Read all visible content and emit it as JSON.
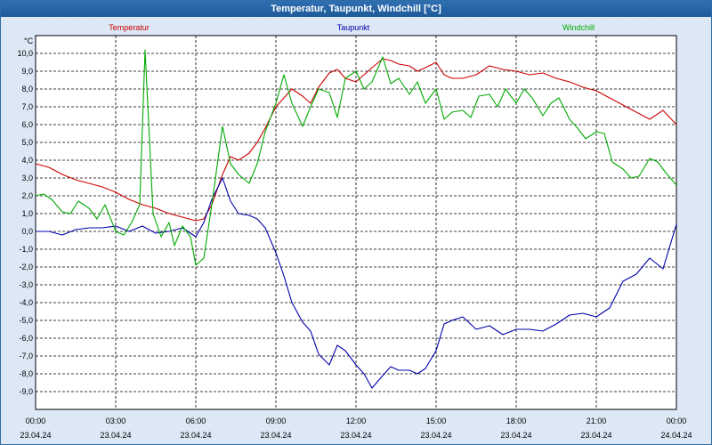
{
  "window": {
    "title": "Temperatur, Taupunkt, Windchill [°C]"
  },
  "colors": {
    "background": "#dce8f5",
    "plot_background": "#ffffff",
    "title_bar": "#2467a8",
    "grid": "#000000",
    "temperatur": "#cc0000",
    "taupunkt": "#0000aa",
    "windchill": "#00aa00"
  },
  "chart_data": {
    "type": "line",
    "title": "Temperatur, Taupunkt, Windchill [°C]",
    "ylabel": "°C",
    "ylim": [
      -10,
      11
    ],
    "xlim": [
      0,
      24
    ],
    "yticks": [
      -9,
      -8,
      -7,
      -6,
      -5,
      -4,
      -3,
      -2,
      -1,
      0,
      1,
      2,
      3,
      4,
      5,
      6,
      7,
      8,
      9,
      10
    ],
    "ytick_labels": [
      "-9,0",
      "-8,0",
      "-7,0",
      "-6,0",
      "-5,0",
      "-4,0",
      "-3,0",
      "-2,0",
      "-1,0",
      "0,0",
      "1,0",
      "2,0",
      "3,0",
      "4,0",
      "5,0",
      "6,0",
      "7,0",
      "8,0",
      "9,0",
      "10,0"
    ],
    "xticks": [
      {
        "time": "00:00",
        "date": "23.04.24",
        "hour": 0
      },
      {
        "time": "03:00",
        "date": "23.04.24",
        "hour": 3
      },
      {
        "time": "06:00",
        "date": "23.04.24",
        "hour": 6
      },
      {
        "time": "09:00",
        "date": "23.04.24",
        "hour": 9
      },
      {
        "time": "12:00",
        "date": "23.04.24",
        "hour": 12
      },
      {
        "time": "15:00",
        "date": "23.04.24",
        "hour": 15
      },
      {
        "time": "18:00",
        "date": "23.04.24",
        "hour": 18
      },
      {
        "time": "21:00",
        "date": "23.04.24",
        "hour": 21
      },
      {
        "time": "00:00",
        "date": "24.04.24",
        "hour": 24
      }
    ],
    "grid": true,
    "series": [
      {
        "name": "Temperatur",
        "color": "#cc0000",
        "x": [
          0,
          0.5,
          1,
          1.5,
          2,
          2.5,
          3,
          3.5,
          4,
          4.5,
          5,
          5.5,
          6,
          6.3,
          6.6,
          7,
          7.3,
          7.6,
          8,
          8.3,
          8.6,
          9,
          9.3,
          9.6,
          10,
          10.3,
          10.6,
          11,
          11.3,
          11.6,
          12,
          12.3,
          12.6,
          13,
          13.3,
          13.6,
          14,
          14.3,
          14.6,
          15,
          15.3,
          15.6,
          16,
          16.5,
          17,
          17.5,
          18,
          18.5,
          19,
          19.5,
          20,
          20.5,
          21,
          21.5,
          22,
          22.5,
          23,
          23.5,
          24
        ],
        "y": [
          3.8,
          3.6,
          3.2,
          2.9,
          2.7,
          2.5,
          2.2,
          1.8,
          1.5,
          1.3,
          1.0,
          0.8,
          0.6,
          0.7,
          1.5,
          3.2,
          4.2,
          4.0,
          4.4,
          5.0,
          5.8,
          7.0,
          7.5,
          8.0,
          7.6,
          7.2,
          8.1,
          8.9,
          9.1,
          8.6,
          8.4,
          8.8,
          9.2,
          9.7,
          9.6,
          9.4,
          9.3,
          9.0,
          9.2,
          9.5,
          8.8,
          8.6,
          8.6,
          8.8,
          9.3,
          9.1,
          9.0,
          8.8,
          8.9,
          8.6,
          8.4,
          8.1,
          7.9,
          7.5,
          7.1,
          6.7,
          6.3,
          6.8,
          6.0
        ]
      },
      {
        "name": "Taupunkt",
        "color": "#0000aa",
        "x": [
          0,
          0.5,
          1,
          1.5,
          2,
          2.5,
          3,
          3.5,
          4,
          4.5,
          5,
          5.5,
          6,
          6.3,
          6.6,
          7,
          7.3,
          7.6,
          8,
          8.3,
          8.6,
          9,
          9.3,
          9.6,
          10,
          10.3,
          10.6,
          11,
          11.3,
          11.6,
          12,
          12.3,
          12.6,
          13,
          13.3,
          13.6,
          14,
          14.3,
          14.6,
          15,
          15.3,
          15.6,
          16,
          16.5,
          17,
          17.5,
          18,
          18.5,
          19,
          19.5,
          20,
          20.5,
          21,
          21.5,
          22,
          22.5,
          23,
          23.5,
          24
        ],
        "y": [
          0.0,
          0.0,
          -0.2,
          0.1,
          0.2,
          0.2,
          0.3,
          0.0,
          0.3,
          -0.1,
          0.0,
          0.2,
          -0.3,
          0.5,
          1.8,
          3.0,
          1.7,
          1.0,
          0.9,
          0.7,
          0.2,
          -1.2,
          -2.5,
          -4.0,
          -5.1,
          -5.6,
          -6.9,
          -7.5,
          -6.4,
          -6.7,
          -7.5,
          -8.0,
          -8.8,
          -8.1,
          -7.6,
          -7.8,
          -7.8,
          -8.0,
          -7.7,
          -6.7,
          -5.2,
          -5.0,
          -4.8,
          -5.5,
          -5.3,
          -5.8,
          -5.5,
          -5.5,
          -5.6,
          -5.2,
          -4.7,
          -4.6,
          -4.8,
          -4.3,
          -2.8,
          -2.4,
          -1.5,
          -2.1,
          0.4
        ]
      },
      {
        "name": "Windchill",
        "color": "#00aa00",
        "x": [
          0,
          0.3,
          0.6,
          1,
          1.3,
          1.6,
          2,
          2.3,
          2.6,
          3,
          3.3,
          3.6,
          3.9,
          4.1,
          4.4,
          4.7,
          5,
          5.2,
          5.5,
          5.8,
          6,
          6.3,
          6.6,
          7,
          7.3,
          7.6,
          8,
          8.3,
          8.6,
          9,
          9.3,
          9.6,
          10,
          10.3,
          10.6,
          11,
          11.3,
          11.6,
          12,
          12.3,
          12.6,
          13,
          13.3,
          13.6,
          14,
          14.3,
          14.6,
          15,
          15.3,
          15.6,
          16,
          16.3,
          16.6,
          17,
          17.3,
          17.6,
          18,
          18.3,
          18.6,
          19,
          19.3,
          19.6,
          20,
          20.3,
          20.6,
          21,
          21.3,
          21.6,
          22,
          22.3,
          22.6,
          23,
          23.3,
          23.6,
          24
        ],
        "y": [
          2.0,
          2.1,
          1.8,
          1.1,
          1.0,
          1.7,
          1.3,
          0.7,
          1.5,
          0.0,
          -0.2,
          0.5,
          1.5,
          10.2,
          1.0,
          -0.3,
          0.5,
          -0.8,
          0.3,
          -0.3,
          -1.9,
          -1.5,
          1.5,
          5.9,
          3.8,
          3.2,
          2.7,
          3.8,
          5.6,
          7.2,
          8.8,
          7.2,
          5.9,
          7.0,
          8.0,
          7.8,
          6.4,
          8.6,
          9.0,
          8.0,
          8.4,
          9.8,
          8.3,
          8.6,
          7.7,
          8.4,
          7.2,
          8.0,
          6.3,
          6.7,
          6.8,
          6.4,
          7.6,
          7.7,
          7.0,
          8.0,
          7.2,
          8.0,
          7.5,
          6.5,
          7.2,
          7.5,
          6.3,
          5.8,
          5.2,
          5.6,
          5.5,
          3.9,
          3.5,
          3.0,
          3.1,
          4.1,
          3.9,
          3.3,
          2.6
        ]
      }
    ]
  },
  "legend": {
    "items": [
      {
        "label": "Temperatur",
        "color": "#cc0000"
      },
      {
        "label": "Taupunkt",
        "color": "#0000aa"
      },
      {
        "label": "Windchill",
        "color": "#00aa00"
      }
    ]
  }
}
